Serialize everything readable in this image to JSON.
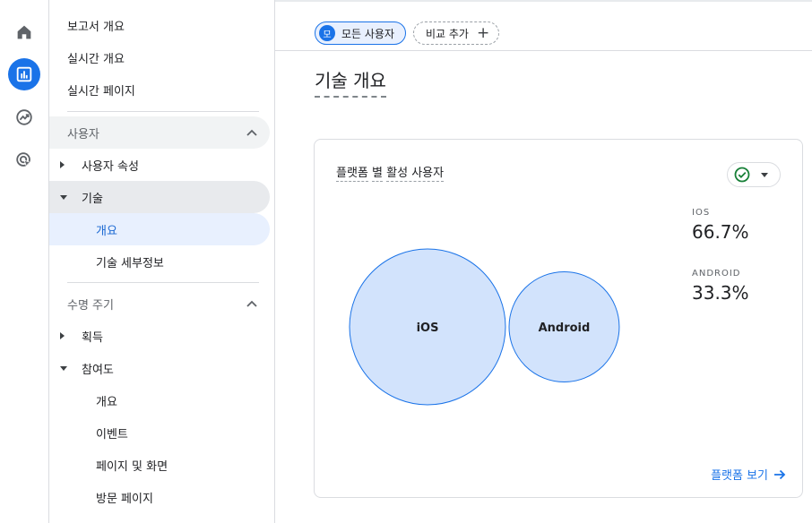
{
  "rail": {
    "items": [
      {
        "name": "home-icon"
      },
      {
        "name": "reports-icon",
        "active": true
      },
      {
        "name": "explore-icon"
      },
      {
        "name": "advertising-icon"
      }
    ],
    "accent": "#1a73e8"
  },
  "nav": {
    "top_items": [
      "보고서 개요",
      "실시간 개요",
      "실시간 페이지"
    ],
    "users_section": "사용자",
    "user_attributes": "사용자 속성",
    "tech": "기술",
    "tech_overview": "개요",
    "tech_details": "기술 세부정보",
    "lifecycle_section": "수명 주기",
    "acquisition": "획득",
    "engagement": "참여도",
    "engagement_items": [
      "개요",
      "이벤트",
      "페이지 및 화면",
      "방문 페이지"
    ]
  },
  "topbar": {
    "segment_badge": "모",
    "segment_label": "모든 사용자",
    "add_comparison": "비교 추가"
  },
  "page": {
    "title": "기술 개요"
  },
  "card": {
    "title_part1": "플랫폼",
    "title_part2": "별",
    "title_part3": "활성 사용자",
    "status_icon": "check-circle-icon",
    "stats": [
      {
        "key": "IOS",
        "value": "66.7%"
      },
      {
        "key": "ANDROID",
        "value": "33.3%"
      }
    ],
    "link": "플랫폼 보기",
    "chart_data": {
      "type": "bubble",
      "items": [
        {
          "label": "iOS",
          "value": 66.7
        },
        {
          "label": "Android",
          "value": 33.3
        }
      ],
      "fill": "#d2e3fc",
      "stroke": "#1a73e8"
    }
  }
}
